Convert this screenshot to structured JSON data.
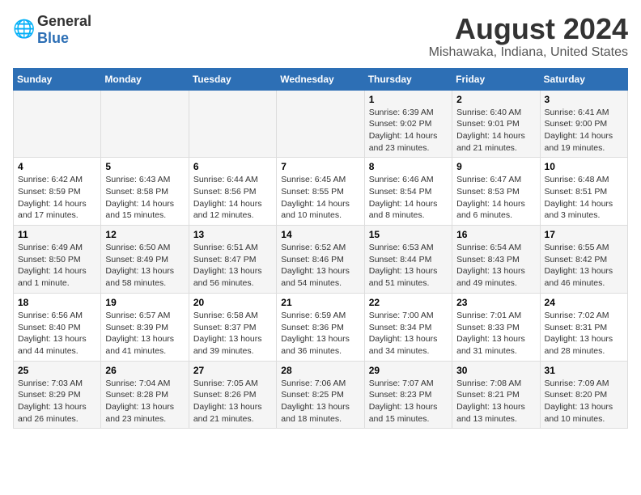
{
  "header": {
    "logo_general": "General",
    "logo_blue": "Blue",
    "title": "August 2024",
    "subtitle": "Mishawaka, Indiana, United States"
  },
  "days_of_week": [
    "Sunday",
    "Monday",
    "Tuesday",
    "Wednesday",
    "Thursday",
    "Friday",
    "Saturday"
  ],
  "weeks": [
    [
      {
        "day": "",
        "content": ""
      },
      {
        "day": "",
        "content": ""
      },
      {
        "day": "",
        "content": ""
      },
      {
        "day": "",
        "content": ""
      },
      {
        "day": "1",
        "content": "Sunrise: 6:39 AM\nSunset: 9:02 PM\nDaylight: 14 hours\nand 23 minutes."
      },
      {
        "day": "2",
        "content": "Sunrise: 6:40 AM\nSunset: 9:01 PM\nDaylight: 14 hours\nand 21 minutes."
      },
      {
        "day": "3",
        "content": "Sunrise: 6:41 AM\nSunset: 9:00 PM\nDaylight: 14 hours\nand 19 minutes."
      }
    ],
    [
      {
        "day": "4",
        "content": "Sunrise: 6:42 AM\nSunset: 8:59 PM\nDaylight: 14 hours\nand 17 minutes."
      },
      {
        "day": "5",
        "content": "Sunrise: 6:43 AM\nSunset: 8:58 PM\nDaylight: 14 hours\nand 15 minutes."
      },
      {
        "day": "6",
        "content": "Sunrise: 6:44 AM\nSunset: 8:56 PM\nDaylight: 14 hours\nand 12 minutes."
      },
      {
        "day": "7",
        "content": "Sunrise: 6:45 AM\nSunset: 8:55 PM\nDaylight: 14 hours\nand 10 minutes."
      },
      {
        "day": "8",
        "content": "Sunrise: 6:46 AM\nSunset: 8:54 PM\nDaylight: 14 hours\nand 8 minutes."
      },
      {
        "day": "9",
        "content": "Sunrise: 6:47 AM\nSunset: 8:53 PM\nDaylight: 14 hours\nand 6 minutes."
      },
      {
        "day": "10",
        "content": "Sunrise: 6:48 AM\nSunset: 8:51 PM\nDaylight: 14 hours\nand 3 minutes."
      }
    ],
    [
      {
        "day": "11",
        "content": "Sunrise: 6:49 AM\nSunset: 8:50 PM\nDaylight: 14 hours\nand 1 minute."
      },
      {
        "day": "12",
        "content": "Sunrise: 6:50 AM\nSunset: 8:49 PM\nDaylight: 13 hours\nand 58 minutes."
      },
      {
        "day": "13",
        "content": "Sunrise: 6:51 AM\nSunset: 8:47 PM\nDaylight: 13 hours\nand 56 minutes."
      },
      {
        "day": "14",
        "content": "Sunrise: 6:52 AM\nSunset: 8:46 PM\nDaylight: 13 hours\nand 54 minutes."
      },
      {
        "day": "15",
        "content": "Sunrise: 6:53 AM\nSunset: 8:44 PM\nDaylight: 13 hours\nand 51 minutes."
      },
      {
        "day": "16",
        "content": "Sunrise: 6:54 AM\nSunset: 8:43 PM\nDaylight: 13 hours\nand 49 minutes."
      },
      {
        "day": "17",
        "content": "Sunrise: 6:55 AM\nSunset: 8:42 PM\nDaylight: 13 hours\nand 46 minutes."
      }
    ],
    [
      {
        "day": "18",
        "content": "Sunrise: 6:56 AM\nSunset: 8:40 PM\nDaylight: 13 hours\nand 44 minutes."
      },
      {
        "day": "19",
        "content": "Sunrise: 6:57 AM\nSunset: 8:39 PM\nDaylight: 13 hours\nand 41 minutes."
      },
      {
        "day": "20",
        "content": "Sunrise: 6:58 AM\nSunset: 8:37 PM\nDaylight: 13 hours\nand 39 minutes."
      },
      {
        "day": "21",
        "content": "Sunrise: 6:59 AM\nSunset: 8:36 PM\nDaylight: 13 hours\nand 36 minutes."
      },
      {
        "day": "22",
        "content": "Sunrise: 7:00 AM\nSunset: 8:34 PM\nDaylight: 13 hours\nand 34 minutes."
      },
      {
        "day": "23",
        "content": "Sunrise: 7:01 AM\nSunset: 8:33 PM\nDaylight: 13 hours\nand 31 minutes."
      },
      {
        "day": "24",
        "content": "Sunrise: 7:02 AM\nSunset: 8:31 PM\nDaylight: 13 hours\nand 28 minutes."
      }
    ],
    [
      {
        "day": "25",
        "content": "Sunrise: 7:03 AM\nSunset: 8:29 PM\nDaylight: 13 hours\nand 26 minutes."
      },
      {
        "day": "26",
        "content": "Sunrise: 7:04 AM\nSunset: 8:28 PM\nDaylight: 13 hours\nand 23 minutes."
      },
      {
        "day": "27",
        "content": "Sunrise: 7:05 AM\nSunset: 8:26 PM\nDaylight: 13 hours\nand 21 minutes."
      },
      {
        "day": "28",
        "content": "Sunrise: 7:06 AM\nSunset: 8:25 PM\nDaylight: 13 hours\nand 18 minutes."
      },
      {
        "day": "29",
        "content": "Sunrise: 7:07 AM\nSunset: 8:23 PM\nDaylight: 13 hours\nand 15 minutes."
      },
      {
        "day": "30",
        "content": "Sunrise: 7:08 AM\nSunset: 8:21 PM\nDaylight: 13 hours\nand 13 minutes."
      },
      {
        "day": "31",
        "content": "Sunrise: 7:09 AM\nSunset: 8:20 PM\nDaylight: 13 hours\nand 10 minutes."
      }
    ]
  ]
}
